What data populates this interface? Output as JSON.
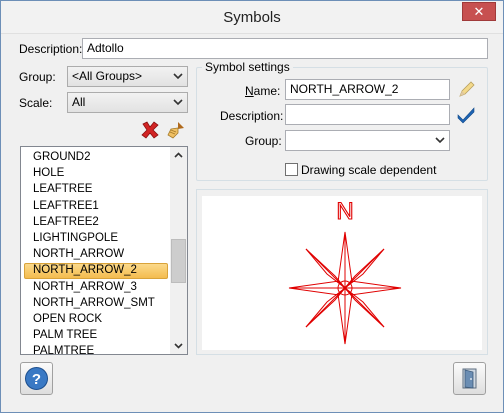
{
  "window": {
    "title": "Symbols",
    "close_glyph": "✕"
  },
  "description": {
    "label": "Description:",
    "value": "Adtollo"
  },
  "group": {
    "label": "Group:",
    "value": "<All Groups>"
  },
  "scale": {
    "label": "Scale:",
    "value": "All"
  },
  "list": {
    "items": [
      "GROUND2",
      "HOLE",
      "LEAFTREE",
      "LEAFTREE1",
      "LEAFTREE2",
      "LIGHTINGPOLE",
      "NORTH_ARROW",
      "NORTH_ARROW_2",
      "NORTH_ARROW_3",
      "NORTH_ARROW_SMT",
      "OPEN ROCK",
      "PALM TREE",
      "PALMTREE"
    ],
    "selected": "NORTH_ARROW_2"
  },
  "symbol_settings": {
    "title": "Symbol settings",
    "name_label": "Name:",
    "name_value": "NORTH_ARROW_2",
    "description_label": "Description:",
    "description_value": "",
    "group_label": "Group:",
    "group_value": "",
    "drawing_scale_label": "Drawing scale dependent",
    "drawing_scale_checked": false
  },
  "preview": {
    "north_letter": "N",
    "symbol_color": "#e00000"
  },
  "colors": {
    "selection": "#f8c867",
    "window_border": "#6d8fb7",
    "close_red": "#c75050"
  },
  "icons": {
    "delete": "red-x-icon",
    "clean": "broom-icon",
    "edit": "pencil-icon",
    "confirm": "checkmark-icon",
    "help": "help-icon",
    "exit": "exit-door-icon"
  }
}
